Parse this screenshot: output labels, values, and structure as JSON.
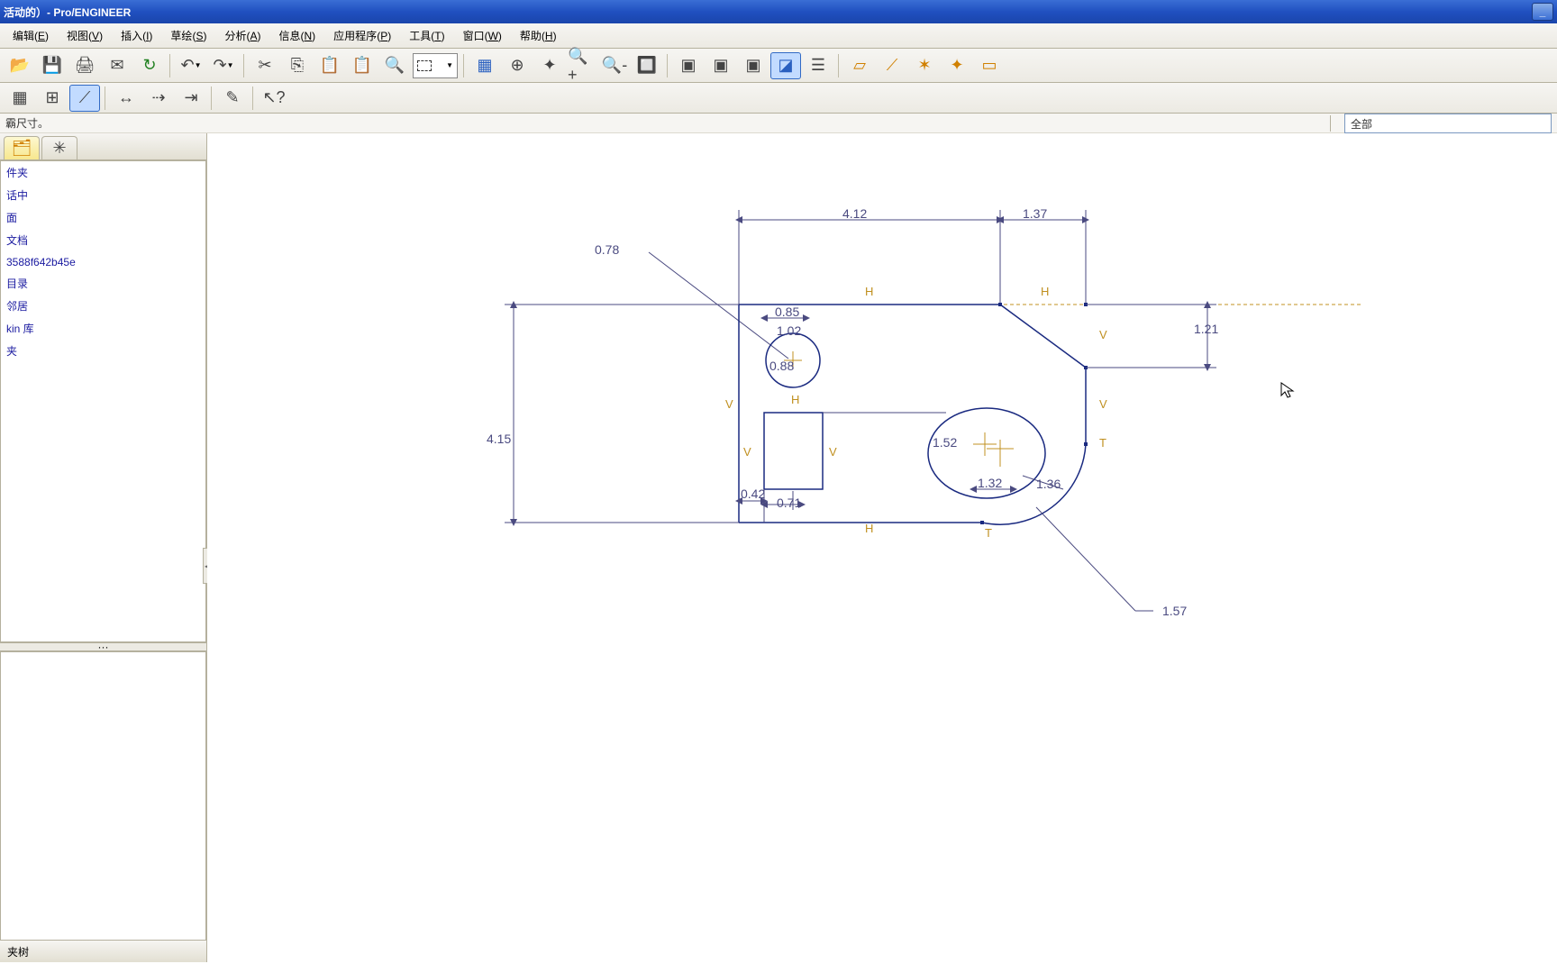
{
  "title_bar": {
    "title": "活动的）- Pro/ENGINEER"
  },
  "menu": {
    "items": [
      {
        "label": "编辑",
        "accel": "E"
      },
      {
        "label": "视图",
        "accel": "V"
      },
      {
        "label": "插入",
        "accel": "I"
      },
      {
        "label": "草绘",
        "accel": "S"
      },
      {
        "label": "分析",
        "accel": "A"
      },
      {
        "label": "信息",
        "accel": "N"
      },
      {
        "label": "应用程序",
        "accel": "P"
      },
      {
        "label": "工具",
        "accel": "T"
      },
      {
        "label": "窗口",
        "accel": "W"
      },
      {
        "label": "帮助",
        "accel": "H"
      }
    ]
  },
  "status": {
    "message": "霸尺寸。",
    "filter_value": "全部"
  },
  "sidebar": {
    "items": [
      {
        "label": "件夹"
      },
      {
        "label": "话中"
      },
      {
        "label": "面"
      },
      {
        "label": "文档"
      },
      {
        "label": "3588f642b45e"
      },
      {
        "label": "目录"
      },
      {
        "label": "邻居"
      },
      {
        "label": "kin 库"
      },
      {
        "label": "夹"
      }
    ],
    "bottom_label": "夹树"
  },
  "sketch": {
    "dims": {
      "d412": "4.12",
      "d137": "1.37",
      "d078": "0.78",
      "d415": "4.15",
      "d121": "1.21",
      "d085": "0.85",
      "d102": "1.02",
      "d088": "0.88",
      "d152": "1.52",
      "d042": "0.42",
      "d071": "0.71",
      "d136": "1.36",
      "d132": "1.32",
      "d157": "1.57"
    },
    "constraints": {
      "H": "H",
      "V": "V",
      "T": "T"
    }
  }
}
